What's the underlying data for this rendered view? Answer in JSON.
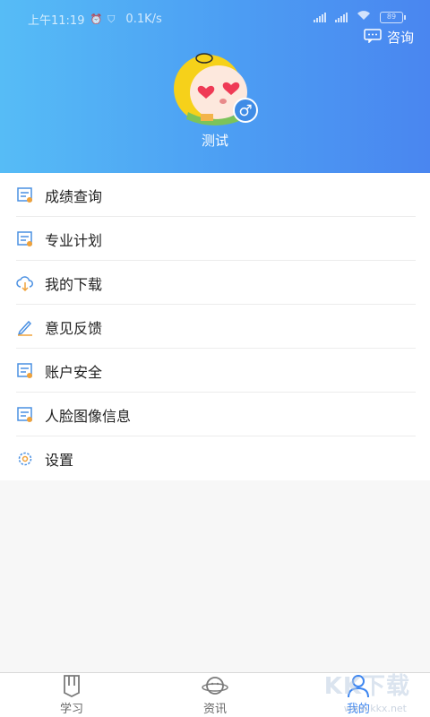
{
  "status_bar": {
    "time": "上午11:19",
    "speed": "0.1K/s",
    "battery": "89"
  },
  "header": {
    "consult_label": "咨询",
    "username": "测试",
    "gender_symbol": "♂"
  },
  "menu": {
    "items": [
      {
        "label": "成绩查询",
        "icon": "document-icon"
      },
      {
        "label": "专业计划",
        "icon": "document-icon"
      },
      {
        "label": "我的下载",
        "icon": "cloud-download-icon"
      },
      {
        "label": "意见反馈",
        "icon": "pencil-icon"
      },
      {
        "label": "账户安全",
        "icon": "document-icon"
      },
      {
        "label": "人脸图像信息",
        "icon": "document-icon"
      },
      {
        "label": "设置",
        "icon": "gear-icon"
      }
    ]
  },
  "tabbar": {
    "tabs": [
      {
        "label": "学习",
        "icon": "book-icon",
        "active": false
      },
      {
        "label": "资讯",
        "icon": "planet-icon",
        "active": false
      },
      {
        "label": "我的",
        "icon": "user-icon",
        "active": true
      }
    ]
  },
  "watermark": {
    "text": "KK下载",
    "url": "www.kkx.net"
  },
  "colors": {
    "header_start": "#56bcf6",
    "header_end": "#4a86f0",
    "accent": "#3e86f0",
    "icon_blue": "#4a90e2",
    "icon_orange": "#f0a23a"
  }
}
